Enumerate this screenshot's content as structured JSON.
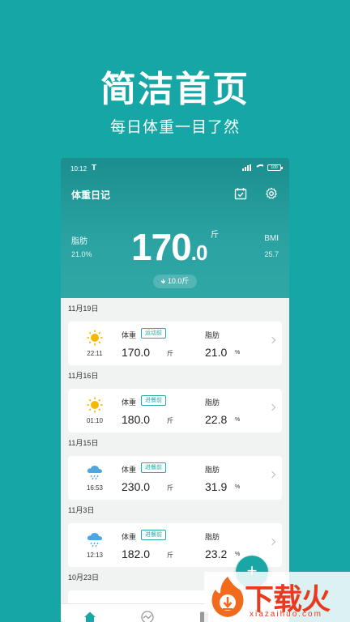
{
  "promo": {
    "title": "简洁首页",
    "subtitle": "每日体重一目了然"
  },
  "status_bar": {
    "time": "10:12",
    "carrier_glyph": "T",
    "battery": "100"
  },
  "header": {
    "app_title": "体重日记",
    "calendar_icon": "calendar-check-icon",
    "settings_icon": "gear-icon",
    "fat_label": "脂肪",
    "fat_value": "21.0%",
    "bmi_label": "BMI",
    "bmi_value": "25.7",
    "weight_int": "170",
    "weight_dec": ".0",
    "weight_unit": "斤",
    "change": "10.0斤",
    "change_direction": "down"
  },
  "records": [
    {
      "date": "11月19日",
      "weather": "sunny",
      "time": "22:11",
      "weight_label": "体重",
      "tag": "运动前",
      "weight": "170.0",
      "weight_unit": "斤",
      "fat_label": "脂肪",
      "fat": "21.0",
      "fat_unit": "%"
    },
    {
      "date": "11月16日",
      "weather": "sunny",
      "time": "01:10",
      "weight_label": "体重",
      "tag": "进餐前",
      "weight": "180.0",
      "weight_unit": "斤",
      "fat_label": "脂肪",
      "fat": "22.8",
      "fat_unit": "%"
    },
    {
      "date": "11月15日",
      "weather": "rain",
      "time": "16:53",
      "weight_label": "体重",
      "tag": "进餐前",
      "weight": "230.0",
      "weight_unit": "斤",
      "fat_label": "脂肪",
      "fat": "31.9",
      "fat_unit": "%"
    },
    {
      "date": "11月3日",
      "weather": "rain",
      "time": "12:13",
      "weight_label": "体重",
      "tag": "进餐前",
      "weight": "182.0",
      "weight_unit": "斤",
      "fat_label": "脂肪",
      "fat": "23.2",
      "fat_unit": "%"
    }
  ],
  "next_date": "10月23日",
  "fab_label": "+",
  "colors": {
    "background": "#17a6a6",
    "accent": "#2aa7a6",
    "sun": "#f5b800",
    "cloud": "#4da6e0"
  },
  "watermark": {
    "text": "下载火",
    "url": "xiazaihuo.com"
  }
}
